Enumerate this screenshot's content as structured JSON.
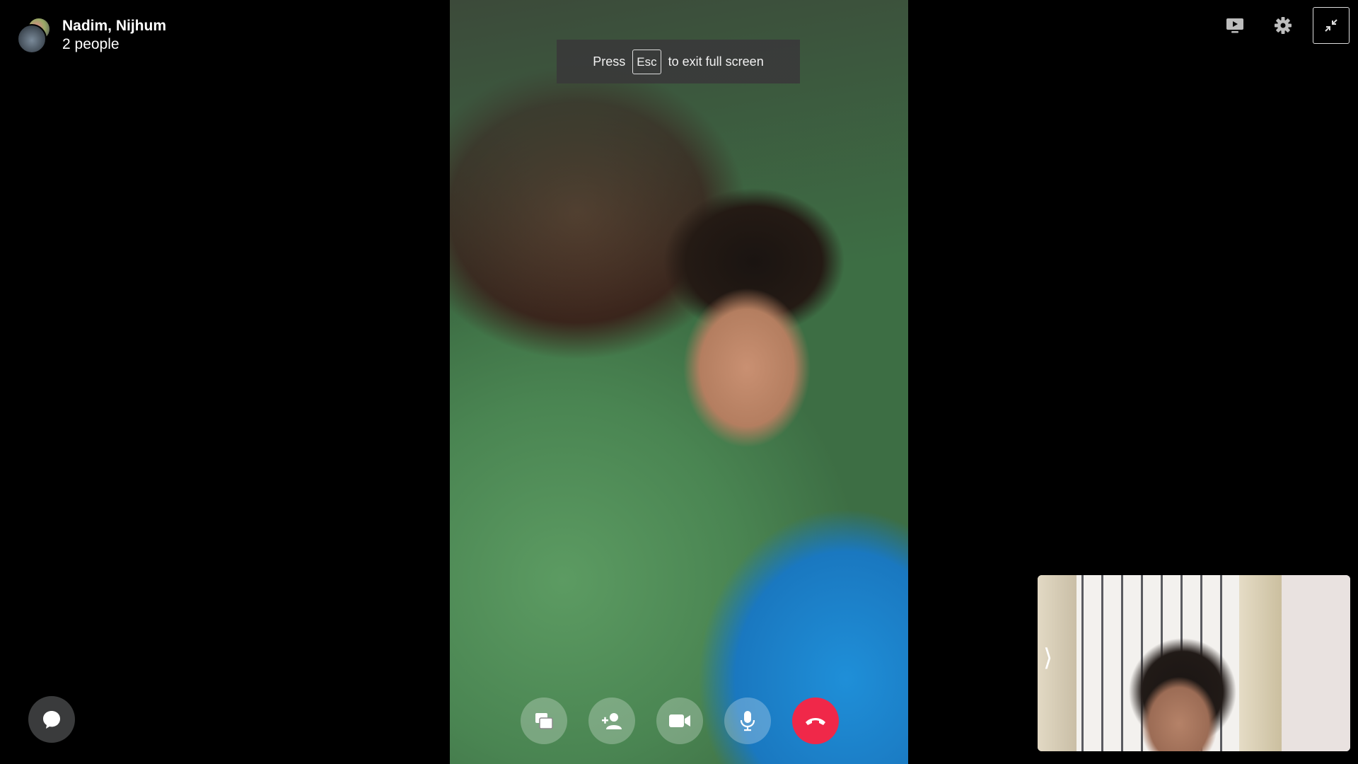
{
  "header": {
    "title": "Nadim, Nijhum",
    "participants": "2 people"
  },
  "toast": {
    "press": "Press",
    "key": "Esc",
    "rest": "to exit full screen"
  },
  "top_controls": {
    "icons": [
      "screen-share-icon",
      "gear-icon",
      "exit-fullscreen-icon"
    ]
  },
  "controls": {
    "icons": [
      "share-screen-icon",
      "add-person-icon",
      "video-camera-icon",
      "microphone-icon",
      "end-call-icon"
    ],
    "end_call_color": "#f02849"
  },
  "self_view": {
    "arrow": "⟩"
  },
  "chat": {
    "icon": "chat-bubble-icon"
  }
}
